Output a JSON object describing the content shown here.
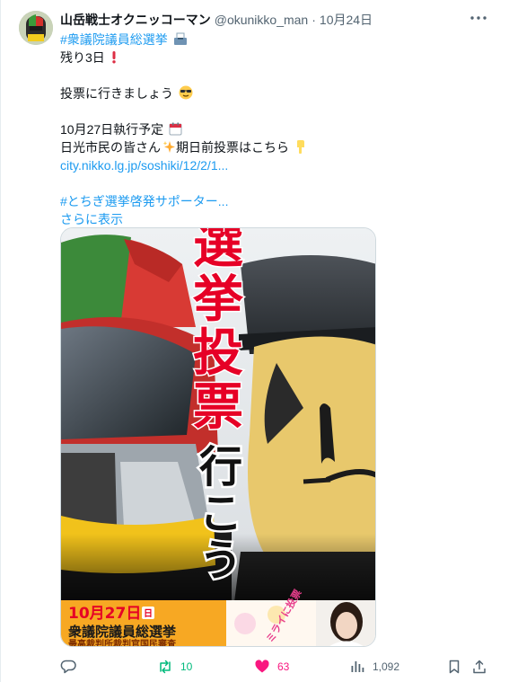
{
  "author": {
    "display_name": "山岳戦士オクニッコーマン",
    "handle": "@okunikko_man",
    "separator": "·",
    "date": "10月24日"
  },
  "tweet": {
    "hashtag_election": "#衆議院議員総選挙",
    "line_days_left": "残り3日",
    "line_go_vote": "投票に行きましょう",
    "line_date": "10月27日執行予定",
    "line_citizens": "日光市民の皆さん",
    "line_early_vote": "期日前投票はこちら",
    "link_url": "city.nikko.lg.jp/soshiki/12/2/1...",
    "hashtag_tochigi": "#とちぎ選挙啓発サポーター...",
    "show_more": "さらに表示"
  },
  "poster": {
    "headline_chars": [
      "選",
      "挙",
      "投",
      "票"
    ],
    "subline_chars": [
      "行",
      "こ",
      "う"
    ],
    "banner_date": "10月27日",
    "banner_weekday": "日",
    "banner_title": "衆議院議員総選挙",
    "banner_subtitle": "最高裁判所裁判官国民審査",
    "side_text": "ミライに投票"
  },
  "actions": {
    "retweets": "10",
    "likes": "63",
    "views": "1,092"
  },
  "icons": {
    "more": "more-dots-icon",
    "reply": "reply-icon",
    "retweet": "retweet-icon",
    "like": "heart-icon",
    "views": "views-icon",
    "bookmark": "bookmark-icon",
    "share": "share-icon"
  },
  "colors": {
    "link": "#1d9bf0",
    "retweet_count": "#00ba7c",
    "like": "#f91880",
    "headline_red": "#e60026"
  }
}
